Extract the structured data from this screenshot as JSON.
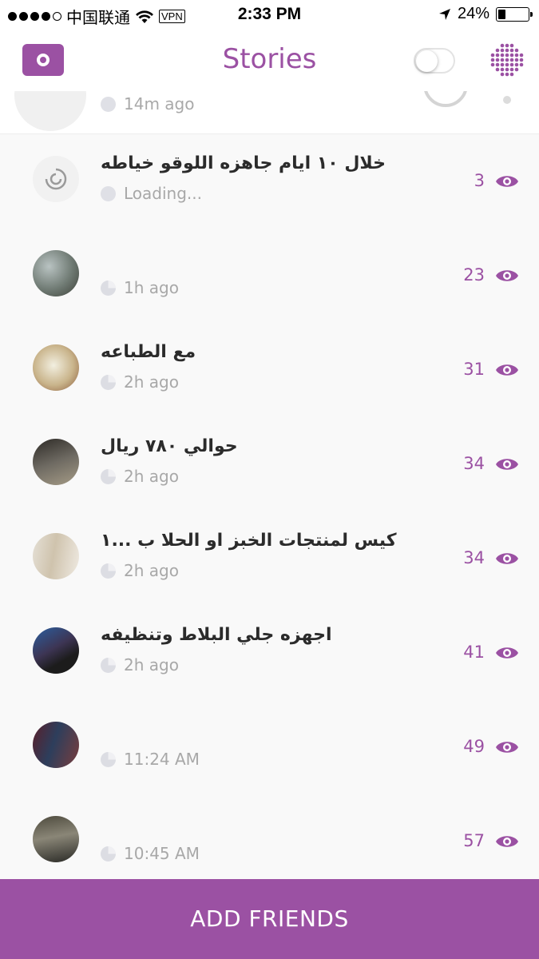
{
  "status_bar": {
    "carrier": "中国联通",
    "vpn": "VPN",
    "time": "2:33 PM",
    "battery": "24%",
    "battery_level": 0.24
  },
  "header": {
    "title": "Stories"
  },
  "partial_row": {
    "timestamp": "14m ago"
  },
  "stories": [
    {
      "caption": "خلال ١٠ ايام جاهزه اللوقو خياطه",
      "timestamp": "Loading...",
      "views": "3",
      "loading": true
    },
    {
      "caption": "",
      "timestamp": "1h ago",
      "views": "23"
    },
    {
      "caption": "مع الطباعه",
      "timestamp": "2h ago",
      "views": "31"
    },
    {
      "caption": "حوالي ٧٨٠ ريال",
      "timestamp": "2h ago",
      "views": "34"
    },
    {
      "caption": "كيس لمنتجات الخبز او الحلا ب ...١",
      "timestamp": "2h ago",
      "views": "34"
    },
    {
      "caption": "اجهزه جلي البلاط وتنظيفه",
      "timestamp": "2h ago",
      "views": "41"
    },
    {
      "caption": "",
      "timestamp": "11:24 AM",
      "views": "49"
    },
    {
      "caption": "",
      "timestamp": "10:45 AM",
      "views": "57"
    }
  ],
  "footer": {
    "add_friends_label": "ADD FRIENDS"
  },
  "colors": {
    "accent": "#9b51a3",
    "muted_text": "#a8a8a8",
    "background": "#f9f9f9"
  }
}
